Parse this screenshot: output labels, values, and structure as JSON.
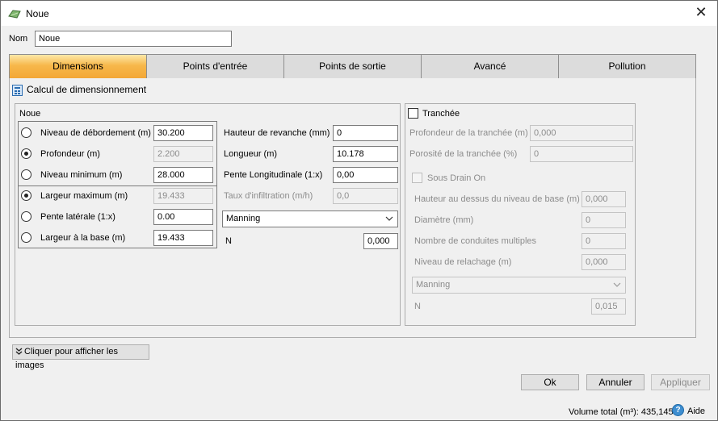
{
  "window": {
    "title": "Noue"
  },
  "name_field": {
    "label": "Nom",
    "value": "Noue"
  },
  "tabs": [
    {
      "label": "Dimensions"
    },
    {
      "label": "Points d'entrée"
    },
    {
      "label": "Points de sortie"
    },
    {
      "label": "Avancé"
    },
    {
      "label": "Pollution"
    }
  ],
  "section_title": "Calcul de dimensionnement",
  "noue": {
    "group_label": "Noue",
    "rows": [
      {
        "label": "Niveau de débordement (m)",
        "value": "30.200"
      },
      {
        "label": "Profondeur (m)",
        "value": "2.200"
      },
      {
        "label": "Niveau minimum (m)",
        "value": "28.000"
      },
      {
        "label": "Largeur maximum (m)",
        "value": "19.433"
      },
      {
        "label": "Pente latérale (1:x)",
        "value": "0.00"
      },
      {
        "label": "Largeur à la base (m)",
        "value": "19.433"
      }
    ],
    "right": [
      {
        "label": "Hauteur de revanche (mm)",
        "value": "0"
      },
      {
        "label": "Longueur (m)",
        "value": "10.178"
      },
      {
        "label": "Pente Longitudinale (1:x)",
        "value": "0,00"
      },
      {
        "label": "Taux d'infiltration (m/h)",
        "value": "0,0"
      }
    ],
    "roughness": "Manning",
    "n_label": "N",
    "n_value": "0,000"
  },
  "trench": {
    "label": "Tranchée",
    "depth": {
      "label": "Profondeur de la tranchée (m)",
      "value": "0,000"
    },
    "porosity": {
      "label": "Porosité de la tranchée (%)",
      "value": "0"
    },
    "subdrain": {
      "label": "Sous Drain On",
      "fields": [
        {
          "label": "Hauteur au dessus du niveau de base (m)",
          "value": "0,000"
        },
        {
          "label": "Diamètre (mm)",
          "value": "0"
        },
        {
          "label": "Nombre de conduites multiples",
          "value": "0"
        },
        {
          "label": "Niveau de relachage (m)",
          "value": "0,000"
        }
      ],
      "roughness": "Manning",
      "n_label": "N",
      "n_value": "0,015"
    }
  },
  "show_images_button": "Cliquer pour afficher les images",
  "buttons": {
    "ok": "Ok",
    "cancel": "Annuler",
    "apply": "Appliquer"
  },
  "footer": {
    "volume_text": "Volume total (m³): 435,145",
    "help_label": "Aide"
  }
}
